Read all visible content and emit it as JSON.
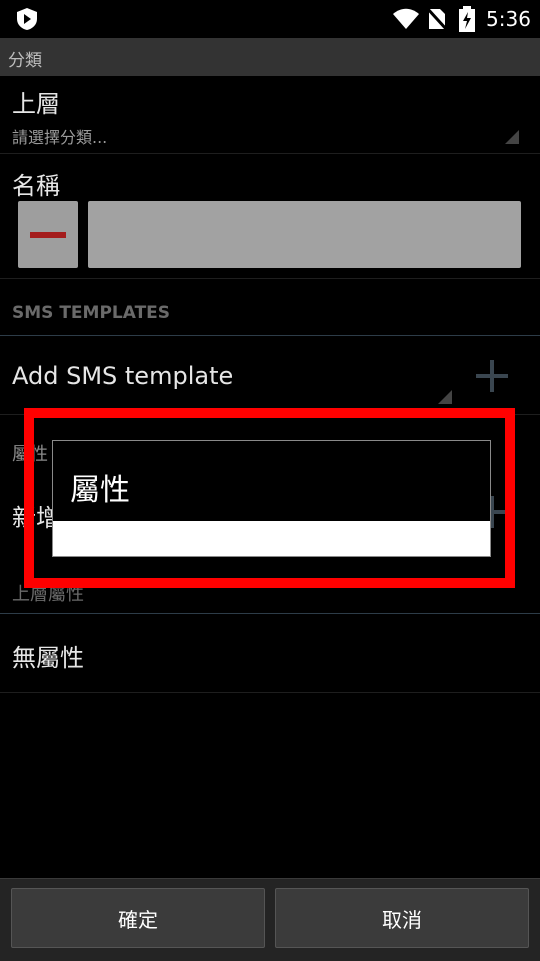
{
  "status_bar": {
    "time": "5:36",
    "icons": [
      "app-shield-icon",
      "wifi-icon",
      "no-sim-icon",
      "battery-charging-icon"
    ]
  },
  "title_bar": {
    "title": "分類"
  },
  "parent": {
    "label": "上層",
    "hint": "請選擇分類..."
  },
  "name": {
    "label": "名稱",
    "value": ""
  },
  "sms": {
    "header": "SMS TEMPLATES",
    "add_label": "Add SMS template"
  },
  "attributes": {
    "header": "屬性",
    "add_label": "新增屬性",
    "parent_header": "上層屬性",
    "none_label": "無屬性"
  },
  "dialog": {
    "title": "屬性",
    "input_value": ""
  },
  "buttons": {
    "ok": "確定",
    "cancel": "取消"
  },
  "colors": {
    "highlight": "#ff0000",
    "minus": "#a41c1c"
  }
}
